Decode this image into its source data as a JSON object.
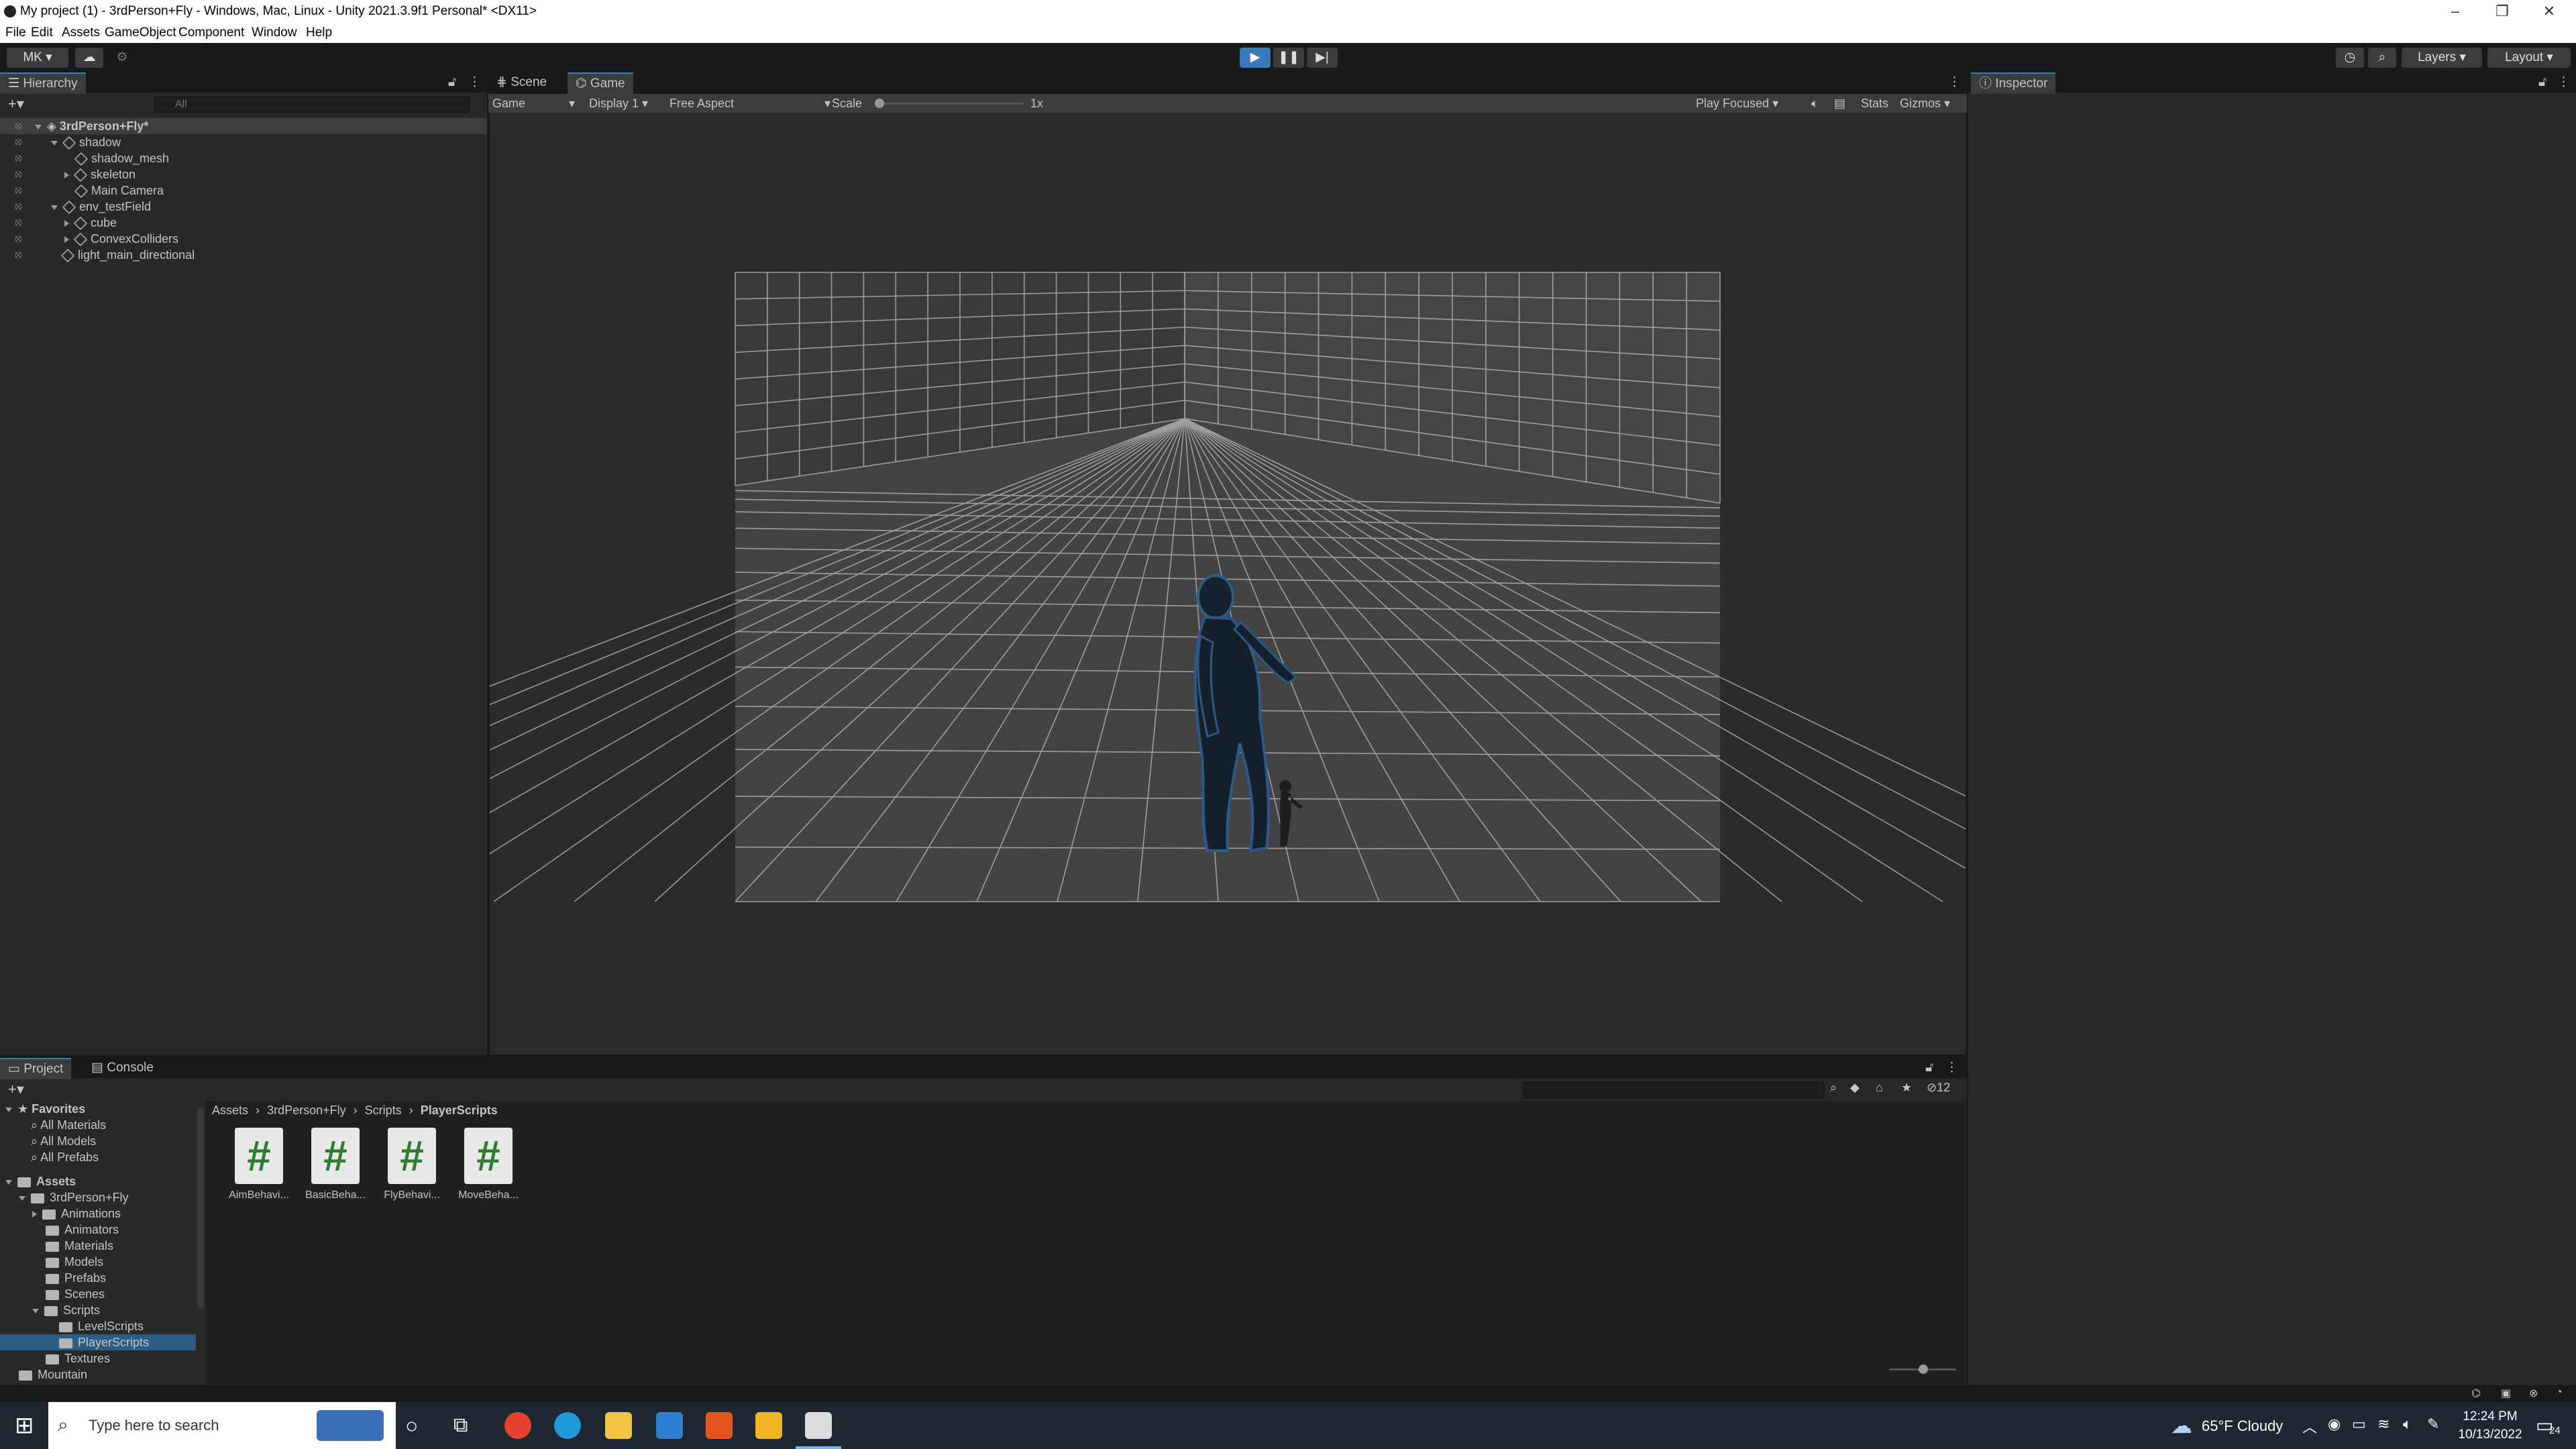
{
  "window": {
    "title": "My project (1) - 3rdPerson+Fly - Windows, Mac, Linux - Unity 2021.3.9f1 Personal* <DX11>"
  },
  "menu": [
    "File",
    "Edit",
    "Assets",
    "GameObject",
    "Component",
    "Window",
    "Help"
  ],
  "toolbar": {
    "account": "MK",
    "layers": "Layers",
    "layout": "Layout"
  },
  "hierarchy": {
    "tab": "Hierarchy",
    "search_placeholder": "All",
    "items": [
      {
        "label": "3rdPerson+Fly*",
        "depth": 0,
        "expanded": true,
        "scene": true
      },
      {
        "label": "shadow",
        "depth": 1,
        "expanded": true
      },
      {
        "label": "shadow_mesh",
        "depth": 2
      },
      {
        "label": "skeleton",
        "depth": 2,
        "collapsed": true
      },
      {
        "label": "Main Camera",
        "depth": 2
      },
      {
        "label": "env_testField",
        "depth": 1,
        "expanded": true
      },
      {
        "label": "cube",
        "depth": 2,
        "collapsed": true
      },
      {
        "label": "ConvexColliders",
        "depth": 2,
        "collapsed": true
      },
      {
        "label": "light_main_directional",
        "depth": 1
      }
    ]
  },
  "center_tabs": {
    "scene": "Scene",
    "game": "Game"
  },
  "game_bar": {
    "mode": "Game",
    "display": "Display 1",
    "aspect": "Free Aspect",
    "scale_label": "Scale",
    "scale_value": "1x",
    "play_focused": "Play Focused",
    "stats": "Stats",
    "gizmos": "Gizmos"
  },
  "inspector": {
    "tab": "Inspector"
  },
  "bottom_tabs": {
    "project": "Project",
    "console": "Console"
  },
  "project": {
    "hidden_count": "12",
    "breadcrumb": [
      "Assets",
      "3rdPerson+Fly",
      "Scripts",
      "PlayerScripts"
    ],
    "favorites_label": "Favorites",
    "favorites": [
      "All Materials",
      "All Models",
      "All Prefabs"
    ],
    "assets_label": "Assets",
    "tree": [
      {
        "label": "3rdPerson+Fly",
        "depth": 1
      },
      {
        "label": "Animations",
        "depth": 2
      },
      {
        "label": "Animators",
        "depth": 2
      },
      {
        "label": "Materials",
        "depth": 2
      },
      {
        "label": "Models",
        "depth": 2
      },
      {
        "label": "Prefabs",
        "depth": 2
      },
      {
        "label": "Scenes",
        "depth": 2
      },
      {
        "label": "Scripts",
        "depth": 2
      },
      {
        "label": "LevelScripts",
        "depth": 3
      },
      {
        "label": "PlayerScripts",
        "depth": 3,
        "selected": true
      },
      {
        "label": "Textures",
        "depth": 2
      },
      {
        "label": "Mountain",
        "depth": 1
      }
    ],
    "files": [
      "AimBehavi...",
      "BasicBeha...",
      "FlyBehavi...",
      "MoveBeha..."
    ]
  },
  "taskbar": {
    "search_placeholder": "Type here to search",
    "weather": "65°F  Cloudy",
    "time": "12:24 PM",
    "date": "10/13/2022",
    "notifications": "24"
  }
}
